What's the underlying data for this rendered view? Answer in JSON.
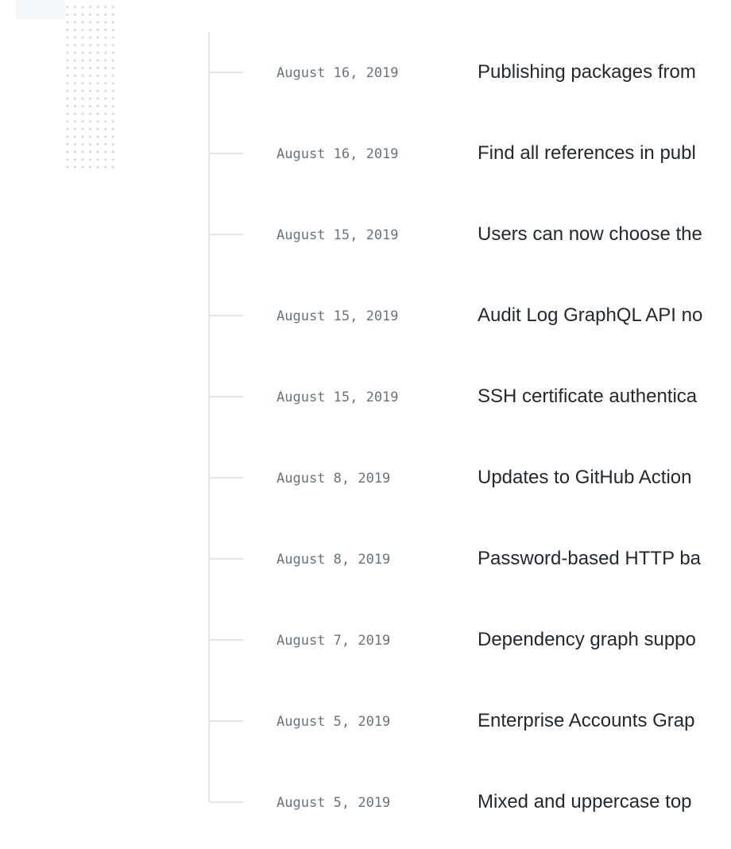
{
  "changelog": {
    "entries": [
      {
        "date": "August 16, 2019",
        "title": "Publishing packages from"
      },
      {
        "date": "August 16, 2019",
        "title": "Find all references in publ"
      },
      {
        "date": "August 15, 2019",
        "title": "Users can now choose the"
      },
      {
        "date": "August 15, 2019",
        "title": "Audit Log GraphQL API no"
      },
      {
        "date": "August 15, 2019",
        "title": "SSH certificate authentica"
      },
      {
        "date": "August 8, 2019",
        "title": "Updates to GitHub Action"
      },
      {
        "date": "August 8, 2019",
        "title": "Password-based HTTP ba"
      },
      {
        "date": "August 7, 2019",
        "title": "Dependency graph suppo"
      },
      {
        "date": "August 5, 2019",
        "title": "Enterprise Accounts Grap"
      },
      {
        "date": "August 5, 2019",
        "title": "Mixed and uppercase top"
      }
    ]
  }
}
